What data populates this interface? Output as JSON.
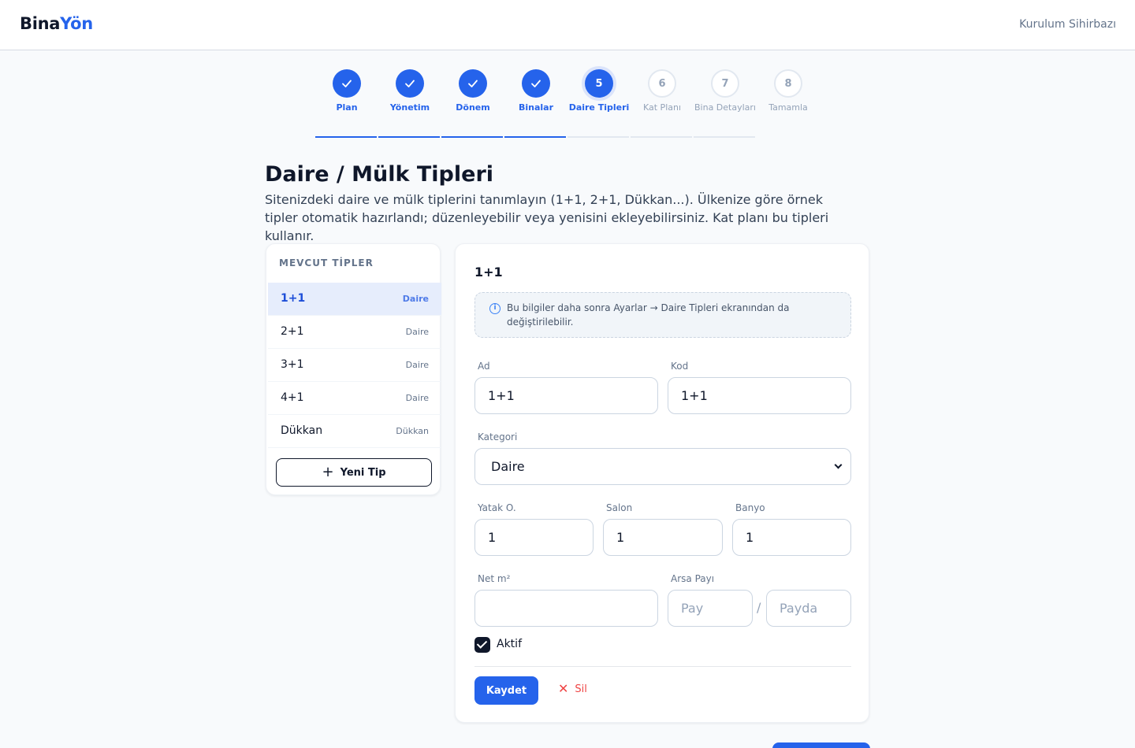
{
  "header": {
    "brand_part1": "Bina",
    "brand_part2": "Yön",
    "wizard_label": "Kurulum Sihirbazı"
  },
  "stepper": {
    "steps": [
      {
        "label": "Plan",
        "state": "done",
        "icon": "check-icon"
      },
      {
        "label": "Yönetim",
        "state": "done",
        "icon": "check-icon"
      },
      {
        "label": "Dönem",
        "state": "done",
        "icon": "check-icon"
      },
      {
        "label": "Binalar",
        "state": "done",
        "icon": "check-icon"
      },
      {
        "number": "5",
        "label": "Daire Tipleri",
        "state": "current"
      },
      {
        "number": "6",
        "label": "Kat Planı",
        "state": "todo"
      },
      {
        "number": "7",
        "label": "Bina Detayları",
        "state": "todo"
      },
      {
        "number": "8",
        "label": "Tamamla",
        "state": "todo"
      }
    ]
  },
  "page": {
    "title": "Daire / Mülk Tipleri",
    "description": "Sitenizdeki daire ve mülk tiplerini tanımlayın (1+1, 2+1, Dükkan...). Ülkenize göre örnek tipler otomatik hazırlandı; düzenleyebilir veya yenisini ekleyebilirsiniz. Kat planı bu tipleri kullanır."
  },
  "types_panel": {
    "heading": "MEVCUT TİPLER",
    "items": [
      {
        "name": "1+1",
        "category": "Daire",
        "active": true
      },
      {
        "name": "2+1",
        "category": "Daire"
      },
      {
        "name": "3+1",
        "category": "Daire"
      },
      {
        "name": "4+1",
        "category": "Daire"
      },
      {
        "name": "Dükkan",
        "category": "Dükkan"
      }
    ],
    "new_button_label": "Yeni Tip"
  },
  "form": {
    "title": "1+1",
    "info_text": "Bu bilgiler daha sonra Ayarlar → Daire Tipleri ekranından da değiştirilebilir.",
    "name": {
      "label": "Ad",
      "value": "1+1"
    },
    "code": {
      "label": "Kod",
      "value": "1+1"
    },
    "category": {
      "label": "Kategori",
      "value": "Daire"
    },
    "bedrooms": {
      "label": "Yatak O.",
      "value": "1"
    },
    "living_rooms": {
      "label": "Salon",
      "value": "1"
    },
    "bathrooms": {
      "label": "Banyo",
      "value": "1"
    },
    "net_area": {
      "label": "Net m²",
      "value": ""
    },
    "land_share": {
      "label": "Arsa Payı",
      "numerator_placeholder": "Pay",
      "denominator_placeholder": "Payda",
      "separator": "/"
    },
    "active": {
      "label": "Aktif",
      "checked": true
    },
    "save_label": "Kaydet",
    "delete_label": "Sil"
  },
  "colors": {
    "accent": "#2563eb",
    "danger": "#ef4444",
    "text": "#0f172a"
  }
}
